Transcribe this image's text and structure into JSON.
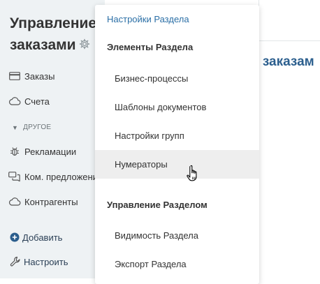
{
  "sidebar": {
    "title_line1": "Управление",
    "title_line2": "заказами",
    "items": [
      {
        "label": "Заказы",
        "icon": "card-icon"
      },
      {
        "label": "Счета",
        "icon": "cloud-icon"
      }
    ],
    "section_label": "ДРУГОЕ",
    "other_items": [
      {
        "label": "Рекламации",
        "icon": "bug-icon"
      },
      {
        "label": "Ком. предложения",
        "icon": "chat-icon"
      },
      {
        "label": "Контрагенты",
        "icon": "cloud-icon"
      }
    ],
    "actions": [
      {
        "label": "Добавить",
        "icon": "plus-circle-icon"
      },
      {
        "label": "Настроить",
        "icon": "wrench-icon"
      }
    ]
  },
  "content": {
    "heading_fragment": "е заказам"
  },
  "menu": {
    "header": "Настройки Раздела",
    "group1": "Элементы Раздела",
    "group1_items": [
      "Бизнес-процессы",
      "Шаблоны документов",
      "Настройки групп",
      "Нумераторы"
    ],
    "group2": "Управление Разделом",
    "group2_items": [
      "Видимость Раздела",
      "Экспорт Раздела"
    ],
    "hovered_item": "Нумераторы"
  },
  "colors": {
    "sidebar_bg": "#eef2f4",
    "link_blue": "#2b6fa6",
    "hover_bg": "#eeeeee",
    "action_icon_blue": "#2a5d8c"
  }
}
